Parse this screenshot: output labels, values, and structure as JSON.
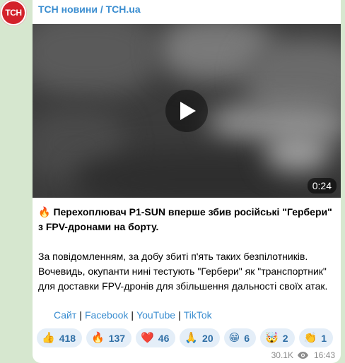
{
  "channel": {
    "avatar_text": "ТСН",
    "name": "ТСН новини / TCH.ua"
  },
  "video": {
    "duration": "0:24"
  },
  "message": {
    "headline_emoji": "🔥",
    "headline": "Перехоплювач P1-SUN вперше збив російські \"Гербери\" з FPV-дронами на борту.",
    "paragraph": "За повідомленням, за добу збиті п'ять таких безпілотників. Вочевидь, окупанти нині тестують \"Гербери\" як \"транспортник\" для доставки FPV-дронів для збільшення дальності своїх атак."
  },
  "links": {
    "site": "Сайт",
    "facebook": "Facebook",
    "youtube": "YouTube",
    "tiktok": "TikTok",
    "separator": "|"
  },
  "reactions": [
    {
      "emoji": "👍",
      "count": "418"
    },
    {
      "emoji": "🔥",
      "count": "137"
    },
    {
      "emoji": "❤️",
      "count": "46"
    },
    {
      "emoji": "🙏",
      "count": "20"
    },
    {
      "emoji": "😁",
      "count": "6"
    },
    {
      "emoji": "🤯",
      "count": "2"
    },
    {
      "emoji": "👏",
      "count": "1"
    }
  ],
  "meta": {
    "views": "30.1K",
    "time": "16:43"
  },
  "colors": {
    "accent": "#3a8dd0",
    "background": "#d6e7cf",
    "avatar": "#d3212b"
  }
}
